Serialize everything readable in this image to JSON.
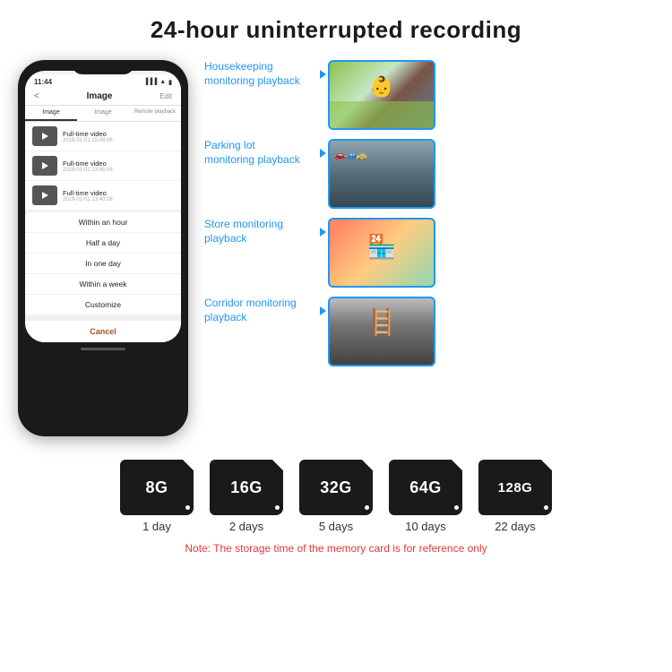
{
  "title": "24-hour uninterrupted recording",
  "phone": {
    "time": "11:44",
    "back": "<",
    "nav_title": "Image",
    "nav_edit": "Edit",
    "tabs": [
      "Image",
      "Image",
      "Remote playback"
    ],
    "list_items": [
      {
        "title": "Full-time video",
        "subtitle": "2019-01-01 15:08:06"
      },
      {
        "title": "Full-time video",
        "subtitle": "2019-01-01 13:45:06"
      },
      {
        "title": "Full-time video",
        "subtitle": "2019-01-01 13:40:08"
      }
    ],
    "dropdown_items": [
      "Within an hour",
      "Half a day",
      "In one day",
      "Within a week",
      "Customize"
    ],
    "cancel_label": "Cancel"
  },
  "monitoring_items": [
    {
      "label": "Housekeeping monitoring playback",
      "image_type": "kids"
    },
    {
      "label": "Parking lot monitoring playback",
      "image_type": "parking"
    },
    {
      "label": "Store monitoring playback",
      "image_type": "store"
    },
    {
      "label": "Corridor monitoring playback",
      "image_type": "corridor"
    }
  ],
  "sdcards": [
    {
      "size": "8G",
      "duration": "1 day"
    },
    {
      "size": "16G",
      "duration": "2 days"
    },
    {
      "size": "32G",
      "duration": "5 days"
    },
    {
      "size": "64G",
      "duration": "10 days"
    },
    {
      "size": "128G",
      "duration": "22 days"
    }
  ],
  "note": "Note: The storage time of the memory card is for reference only"
}
